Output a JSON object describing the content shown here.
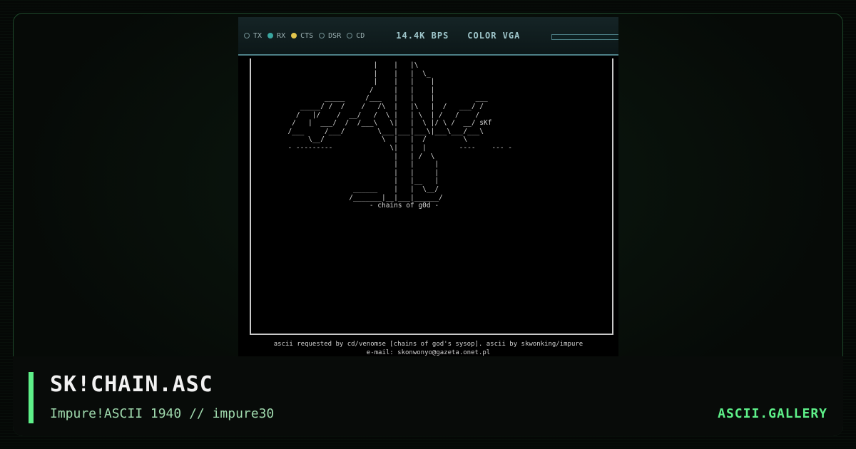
{
  "terminal": {
    "indicators": [
      {
        "label": "TX",
        "state": "off"
      },
      {
        "label": "RX",
        "state": "on",
        "color": "#3aa6a0"
      },
      {
        "label": "CTS",
        "state": "on",
        "color": "#e2c54c"
      },
      {
        "label": "DSR",
        "state": "off"
      },
      {
        "label": "CD",
        "state": "off"
      }
    ],
    "speed": "14.4K BPS",
    "mode": "COLOR VGA",
    "ascii_art": "                       |    |   |\\\n                       |    |   |  \\_\n                       |    |   |    |\n                      /     |   |    |\n           _____     /___   |   |    |          ___\n     _____/ /  /    /   /\\  |   |\\   |  /   ___/ /\n    /   |/    /  __/   /  \\ |   | \\  | /   /    /\n   /   |  ___/  /  /___\\   \\|   |  \\ |/ \\ /  __/ sKf\n  /___     /___/        \\___|___|___\\|___\\___/___\\\n       \\__/              \\  |   |  /         \\\n  - ---------              \\|   |  |        ----    --- -\n                            |   | /  \\\n                            |   |     |\n                            |   |     |\n                            |   |__   |\n                  ______    |   |  \\__/\n                 /_______|__|___|______/\n                      - chains of g0d -",
    "credits": [
      "ascii requested by cd/venomse [chains of god's sysop]. ascii by skwonking/impure",
      "e-mail: skonwonyo@gazeta.onet.pl"
    ]
  },
  "caption": {
    "title": "SK!CHAIN.ASC",
    "subtitle": "Impure!ASCII 1940 // impure30",
    "brand": "ASCII.GALLERY"
  },
  "colors": {
    "accent": "#5ef089",
    "background": "#050806",
    "status_border": "#4d7f86"
  }
}
